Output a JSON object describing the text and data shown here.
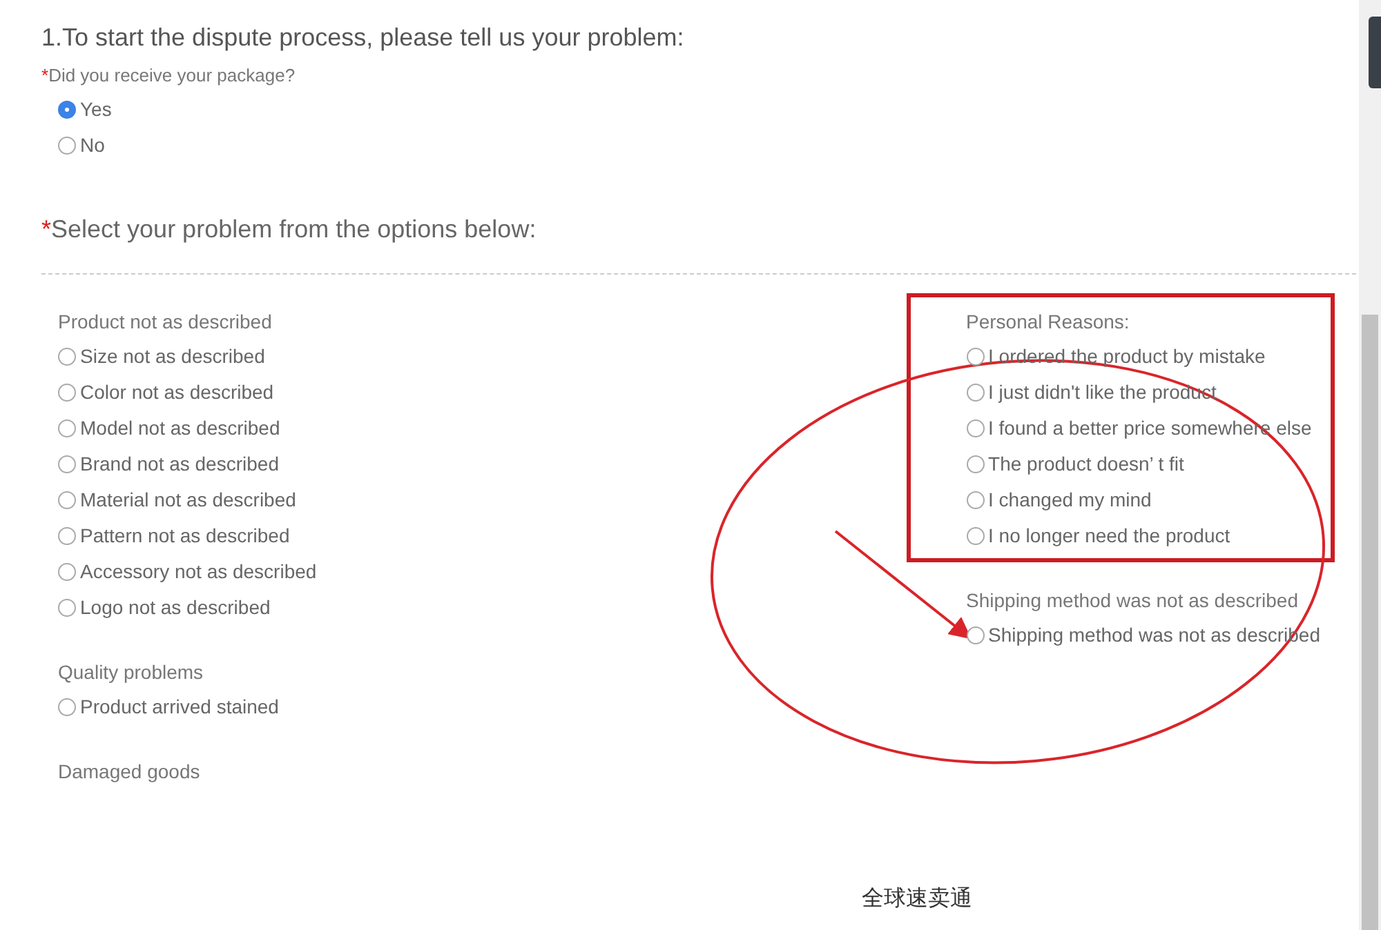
{
  "question": {
    "title": "1.To start the dispute process, please tell us your problem:",
    "required_mark": "*",
    "prompt": "Did you receive your package?",
    "options": [
      {
        "label": "Yes",
        "selected": true
      },
      {
        "label": "No",
        "selected": false
      }
    ]
  },
  "problem": {
    "required_mark": "*",
    "title": "Select your problem from the options below:",
    "columns": [
      [
        {
          "heading": "Product not as described",
          "options": [
            {
              "label": "Size not as described",
              "selected": false
            },
            {
              "label": "Color not as described",
              "selected": false
            },
            {
              "label": "Model not as described",
              "selected": false
            },
            {
              "label": "Brand not as described",
              "selected": false
            },
            {
              "label": "Material not as described",
              "selected": false
            },
            {
              "label": "Pattern not as described",
              "selected": false
            },
            {
              "label": "Accessory not as described",
              "selected": false
            },
            {
              "label": "Logo not as described",
              "selected": false
            }
          ]
        },
        {
          "heading": "Quality problems",
          "options": [
            {
              "label": "Product arrived stained",
              "selected": false
            }
          ]
        },
        {
          "heading": "Damaged goods"
        }
      ],
      [
        {
          "heading": "Personal Reasons:",
          "options": [
            {
              "label": "I ordered the product by mistake",
              "selected": false
            },
            {
              "label": "I just didn't like the product",
              "selected": false
            },
            {
              "label": "I found a better price somewhere else",
              "selected": false
            },
            {
              "label": "The product doesn’ t fit",
              "selected": false
            },
            {
              "label": "I changed my mind",
              "selected": false
            },
            {
              "label": "I no longer need the product",
              "selected": false
            }
          ]
        },
        {
          "heading": "Shipping method was not as described",
          "options": [
            {
              "label": "Shipping method was not as described",
              "selected": false
            }
          ]
        }
      ]
    ]
  },
  "caption": "全球速卖通"
}
